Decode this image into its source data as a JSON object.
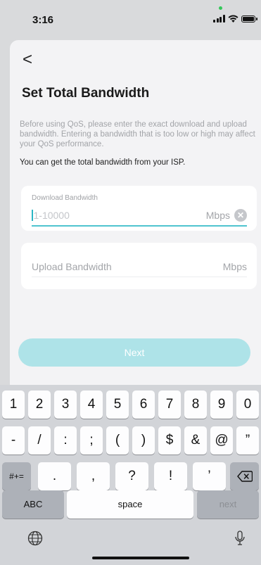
{
  "status_bar": {
    "time": "3:16",
    "signal_icon": "cellular-signal-icon",
    "wifi_icon": "wifi-icon",
    "battery_icon": "battery-icon"
  },
  "page": {
    "back_symbol": "<",
    "title": "Set Total Bandwidth",
    "description": "Before using QoS, please enter the exact download and upload bandwidth. Entering a bandwidth that is too low or high may affect your QoS performance.",
    "isp_note": "You can get the total bandwidth from your ISP."
  },
  "download": {
    "label": "Download Bandwidth",
    "placeholder": "1-10000",
    "value": "",
    "unit": "Mbps",
    "clear_symbol": "✕"
  },
  "upload": {
    "placeholder": "Upload Bandwidth",
    "unit": "Mbps"
  },
  "next_button": {
    "label": "Next"
  },
  "keyboard": {
    "row1": [
      "1",
      "2",
      "3",
      "4",
      "5",
      "6",
      "7",
      "8",
      "9",
      "0"
    ],
    "row2": [
      "-",
      "/",
      ":",
      ";",
      "(",
      ")",
      "$",
      "&",
      "@",
      "”"
    ],
    "row3_toggle": "#+=",
    "row3": [
      ".",
      ",",
      "?",
      "!",
      "’"
    ],
    "delete_icon": "backspace-icon",
    "abc_label": "ABC",
    "space_label": "space",
    "next_label": "next",
    "globe_icon": "globe-icon",
    "mic_icon": "microphone-icon"
  }
}
